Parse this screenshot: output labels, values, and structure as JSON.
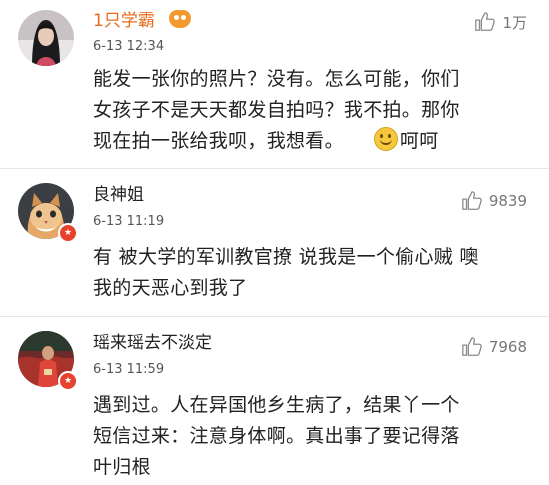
{
  "comments": [
    {
      "username": "1只学霸",
      "time": "6-13 12:34",
      "likes": "1万",
      "text_before_emoji": "能发一张你的照片？没有。怎么可能，你们\n女孩子不是天天都发自拍吗？我不拍。那你\n现在拍一张给我呗，我想看。",
      "text_after_emoji": "呵呵"
    },
    {
      "username": "良神姐",
      "time": "6-13 11:19",
      "likes": "9839",
      "text": "有 被大学的军训教官撩 说我是一个偷心贼 噢\n我的天恶心到我了"
    },
    {
      "username": "瑶来瑶去不淡定",
      "time": "6-13 11:59",
      "likes": "7968",
      "text": "遇到过。人在异国他乡生病了，结果丫一个\n短信过来：注意身体啊。真出事了要记得落\n叶归根"
    }
  ],
  "icons": {
    "like": "thumbs-up-icon",
    "vip": "vip-badge-icon",
    "verified": "verified-badge-icon",
    "emoji": "smile-emoji-icon"
  },
  "colors": {
    "vip_username": "#e66b1e",
    "badge": "#e8412c",
    "like_text": "#777777"
  }
}
